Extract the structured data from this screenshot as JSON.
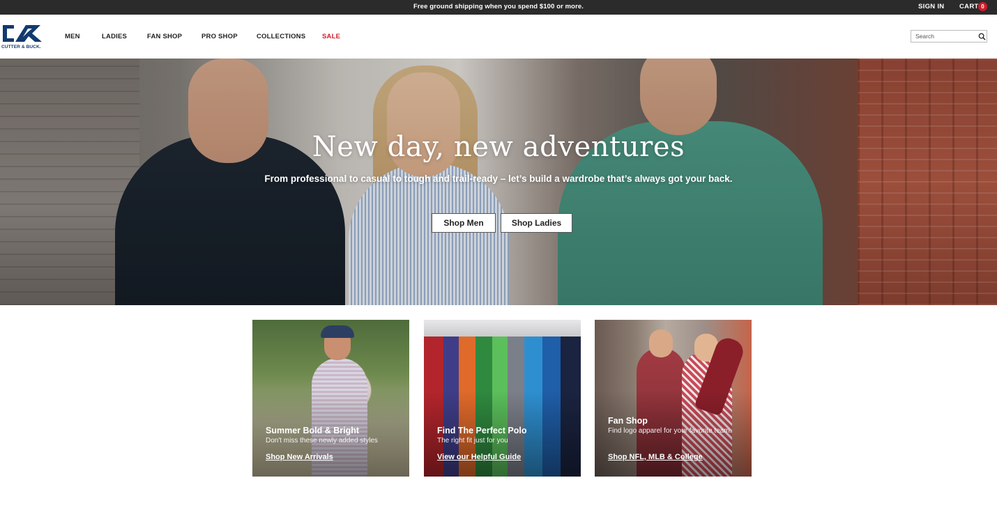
{
  "topbar": {
    "promo": "Free ground shipping when you spend $100 or more.",
    "sign_in": "SIGN IN",
    "cart_label": "CART",
    "cart_count": "0"
  },
  "header": {
    "logo_text": "CUTTER & BUCK.",
    "nav": [
      {
        "label": "MEN"
      },
      {
        "label": "LADIES"
      },
      {
        "label": "FAN SHOP"
      },
      {
        "label": "PRO SHOP"
      },
      {
        "label": "COLLECTIONS"
      },
      {
        "label": "SALE"
      }
    ],
    "search_placeholder": "Search"
  },
  "hero": {
    "title": "New day, new adventures",
    "subtitle": "From professional to casual to tough and trail-ready – let’s build a wardrobe that’s always got your back.",
    "btn_men": "Shop Men",
    "btn_ladies": "Shop Ladies"
  },
  "cards": [
    {
      "title": "Summer Bold & Bright",
      "desc": "Don't miss these newly added styles",
      "link": "Shop New Arrivals"
    },
    {
      "title": "Find The Perfect Polo",
      "desc": "The right fit just for you",
      "link": "View our Helpful Guide"
    },
    {
      "title": "Fan Shop",
      "desc": "Find logo apparel for your favorite team.",
      "link": "Shop NFL, MLB & College"
    }
  ],
  "colors": {
    "brand": "#123a6e",
    "sale": "#d01c2b",
    "topbar": "#2b2b2b"
  }
}
